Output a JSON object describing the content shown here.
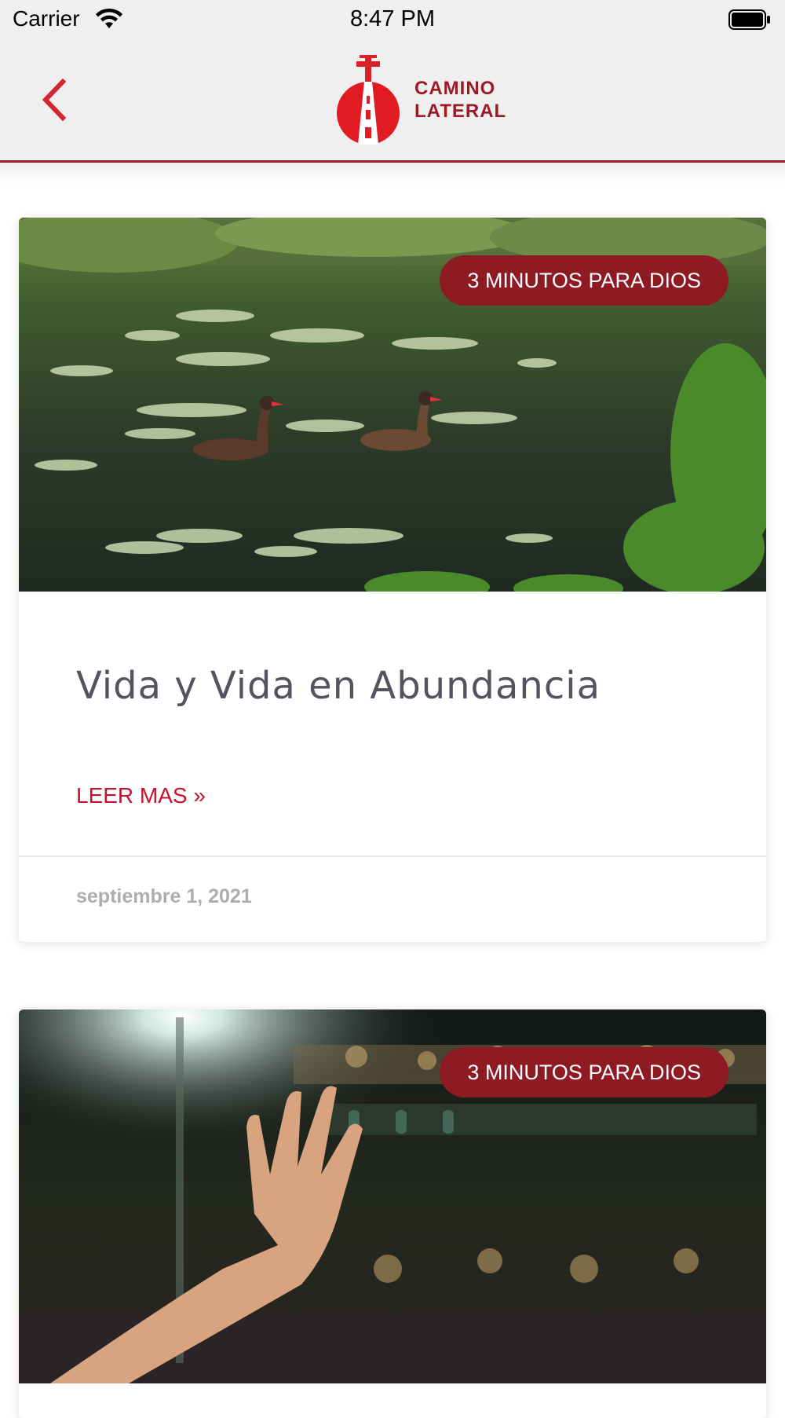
{
  "status_bar": {
    "carrier": "Carrier",
    "time": "8:47 PM",
    "wifi_icon": "wifi-icon",
    "battery_icon": "battery-icon"
  },
  "nav": {
    "back_icon": "chevron-left-icon",
    "logo_line1": "CAMINO",
    "logo_line2": "LATERAL",
    "accent_color": "#9b1b24"
  },
  "posts": [
    {
      "category": "3 MINUTOS PARA DIOS",
      "title": "Vida y Vida en Abundancia",
      "read_more": "LEER MAS »",
      "date": "septiembre 1, 2021",
      "image": "ducks-swimming-in-pond-with-lily-pads"
    },
    {
      "category": "3 MINUTOS PARA DIOS",
      "image": "raised-hand-at-night-crowd"
    }
  ],
  "colors": {
    "badge": "#8e1b24",
    "link": "#c4122f",
    "title": "#52555d",
    "date": "#adadad"
  }
}
